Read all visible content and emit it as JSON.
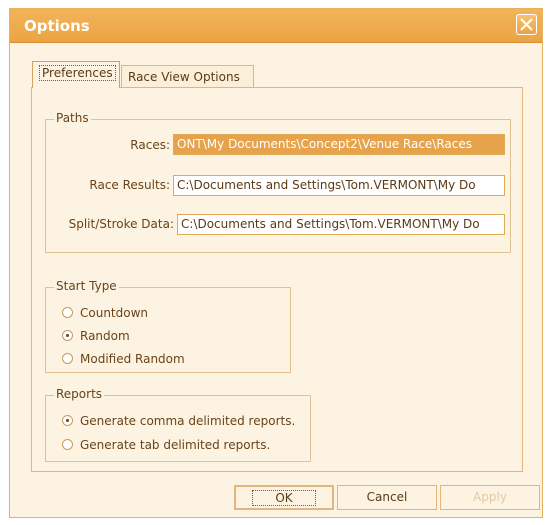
{
  "window": {
    "title": "Options"
  },
  "tabs": [
    {
      "label": "Preferences"
    },
    {
      "label": "Race View Options"
    }
  ],
  "paths": {
    "group_label": "Paths",
    "rows": [
      {
        "label": "Races:",
        "value": "ONT\\My Documents\\Concept2\\Venue Race\\Races"
      },
      {
        "label": "Race Results:",
        "value": "C:\\Documents and Settings\\Tom.VERMONT\\My Do"
      },
      {
        "label": "Split/Stroke Data:",
        "value": "C:\\Documents and Settings\\Tom.VERMONT\\My Do"
      }
    ]
  },
  "start_type": {
    "group_label": "Start Type",
    "options": [
      {
        "label": "Countdown",
        "checked": false
      },
      {
        "label": "Random",
        "checked": true
      },
      {
        "label": "Modified Random",
        "checked": false
      }
    ]
  },
  "reports": {
    "group_label": "Reports",
    "options": [
      {
        "label": "Generate comma delimited reports.",
        "checked": true
      },
      {
        "label": "Generate tab delimited reports.",
        "checked": false
      }
    ]
  },
  "buttons": {
    "ok": "OK",
    "cancel": "Cancel",
    "apply": "Apply"
  },
  "colors": {
    "titlebar": "#eba443",
    "accent": "#e7a34b",
    "panel": "#fdf3e3"
  }
}
